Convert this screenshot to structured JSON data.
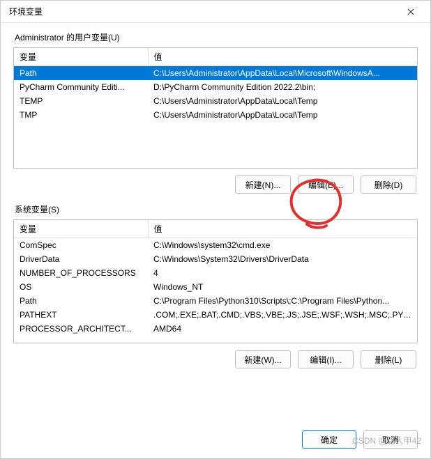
{
  "window": {
    "title": "环境变量"
  },
  "userVars": {
    "label": "Administrator 的用户变量(U)",
    "headers": {
      "name": "变量",
      "value": "值"
    },
    "rows": [
      {
        "name": "Path",
        "value": "C:\\Users\\Administrator\\AppData\\Local\\Microsoft\\WindowsA...",
        "selected": true
      },
      {
        "name": "PyCharm Community Editi...",
        "value": "D:\\PyCharm Community Edition 2022.2\\bin;",
        "selected": false
      },
      {
        "name": "TEMP",
        "value": "C:\\Users\\Administrator\\AppData\\Local\\Temp",
        "selected": false
      },
      {
        "name": "TMP",
        "value": "C:\\Users\\Administrator\\AppData\\Local\\Temp",
        "selected": false
      }
    ],
    "buttons": {
      "new": "新建(N)...",
      "edit": "编辑(E)...",
      "delete": "删除(D)"
    }
  },
  "sysVars": {
    "label": "系统变量(S)",
    "headers": {
      "name": "变量",
      "value": "值"
    },
    "rows": [
      {
        "name": "ComSpec",
        "value": "C:\\Windows\\system32\\cmd.exe"
      },
      {
        "name": "DriverData",
        "value": "C:\\Windows\\System32\\Drivers\\DriverData"
      },
      {
        "name": "NUMBER_OF_PROCESSORS",
        "value": "4"
      },
      {
        "name": "OS",
        "value": "Windows_NT"
      },
      {
        "name": "Path",
        "value": "C:\\Program Files\\Python310\\Scripts\\;C:\\Program Files\\Python..."
      },
      {
        "name": "PATHEXT",
        "value": ".COM;.EXE;.BAT;.CMD;.VBS;.VBE;.JS;.JSE;.WSF;.WSH;.MSC;.PY;.P..."
      },
      {
        "name": "PROCESSOR_ARCHITECT...",
        "value": "AMD64"
      }
    ],
    "buttons": {
      "new": "新建(W)...",
      "edit": "编辑(I)...",
      "delete": "删除(L)"
    }
  },
  "footer": {
    "ok": "确定",
    "cancel": "取消"
  },
  "watermark": "CSDN @路人甲42"
}
